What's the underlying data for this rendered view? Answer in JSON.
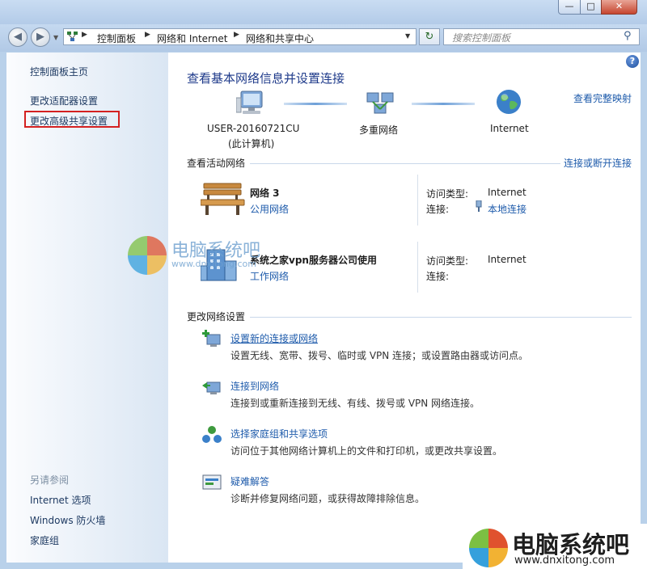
{
  "window": {
    "minimize_glyph": "—",
    "maximize_glyph": "□",
    "close_glyph": "✕"
  },
  "nav": {
    "back_glyph": "◀",
    "forward_glyph": "▶",
    "history_glyph": "▼",
    "refresh_glyph": "↻",
    "dropdown_glyph": "▼",
    "breadcrumb": [
      "控制面板",
      "网络和 Internet",
      "网络和共享中心"
    ],
    "search_placeholder": "搜索控制面板"
  },
  "sidebar": {
    "items": [
      {
        "label": "控制面板主页"
      },
      {
        "label": "更改适配器设置"
      },
      {
        "label": "更改高级共享设置"
      }
    ],
    "see_also_label": "另请参阅",
    "see_also": [
      {
        "label": "Internet 选项"
      },
      {
        "label": "Windows 防火墙"
      },
      {
        "label": "家庭组"
      }
    ]
  },
  "main": {
    "help_glyph": "?",
    "title": "查看基本网络信息并设置连接",
    "view_full_map": "查看完整映射",
    "map": {
      "computer_name": "USER-20160721CU",
      "computer_sub": "(此计算机)",
      "network_label": "多重网络",
      "internet_label": "Internet"
    },
    "active_networks_title": "查看活动网络",
    "connect_disconnect": "连接或断开连接",
    "networks": [
      {
        "name": "网络  3",
        "type": "公用网络",
        "access_label": "访问类型:",
        "access_value": "Internet",
        "conn_label": "连接:",
        "conn_value": "本地连接"
      },
      {
        "name": "系统之家vpn服务器公司使用",
        "type": "工作网络",
        "access_label": "访问类型:",
        "access_value": "Internet",
        "conn_label": "连接:",
        "conn_value": ""
      }
    ],
    "change_settings_title": "更改网络设置",
    "tasks": [
      {
        "title": "设置新的连接或网络",
        "desc": "设置无线、宽带、拨号、临时或 VPN 连接；或设置路由器或访问点。"
      },
      {
        "title": "连接到网络",
        "desc": "连接到或重新连接到无线、有线、拨号或 VPN 网络连接。"
      },
      {
        "title": "选择家庭组和共享选项",
        "desc": "访问位于其他网络计算机上的文件和打印机，或更改共享设置。"
      },
      {
        "title": "疑难解答",
        "desc": "诊断并修复网络问题，或获得故障排除信息。"
      }
    ]
  },
  "watermark": {
    "center_brand": "电脑系统吧",
    "center_url": "www.dnxitong.com",
    "corner_brand": "电脑系统吧",
    "corner_url": "www.dnxitong.com"
  }
}
